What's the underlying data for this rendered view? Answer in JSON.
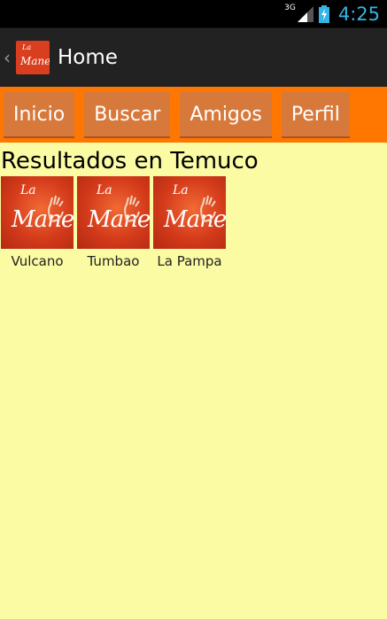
{
  "status_bar": {
    "network": "3G",
    "time": "4:25"
  },
  "action_bar": {
    "app_icon_text_top": "La",
    "app_icon_text_bottom": "Mane",
    "title": "Home"
  },
  "tabs": [
    {
      "label": "Inicio"
    },
    {
      "label": "Buscar"
    },
    {
      "label": "Amigos"
    },
    {
      "label": "Perfil"
    }
  ],
  "results_title": "Resultados en Temuco",
  "results": [
    {
      "name": "Vulcano",
      "logo_text_top": "La",
      "logo_text_bottom": "Mane"
    },
    {
      "name": "Tumbao",
      "logo_text_top": "La",
      "logo_text_bottom": "Mane"
    },
    {
      "name": "La Pampa",
      "logo_text_top": "La",
      "logo_text_bottom": "Mane"
    }
  ],
  "colors": {
    "background": "#fbfba4",
    "tabbar": "#ff7700",
    "tab_button": "#d8793c",
    "action_bar": "#222222",
    "clock": "#33b5e5",
    "logo": "#d33a1a"
  }
}
